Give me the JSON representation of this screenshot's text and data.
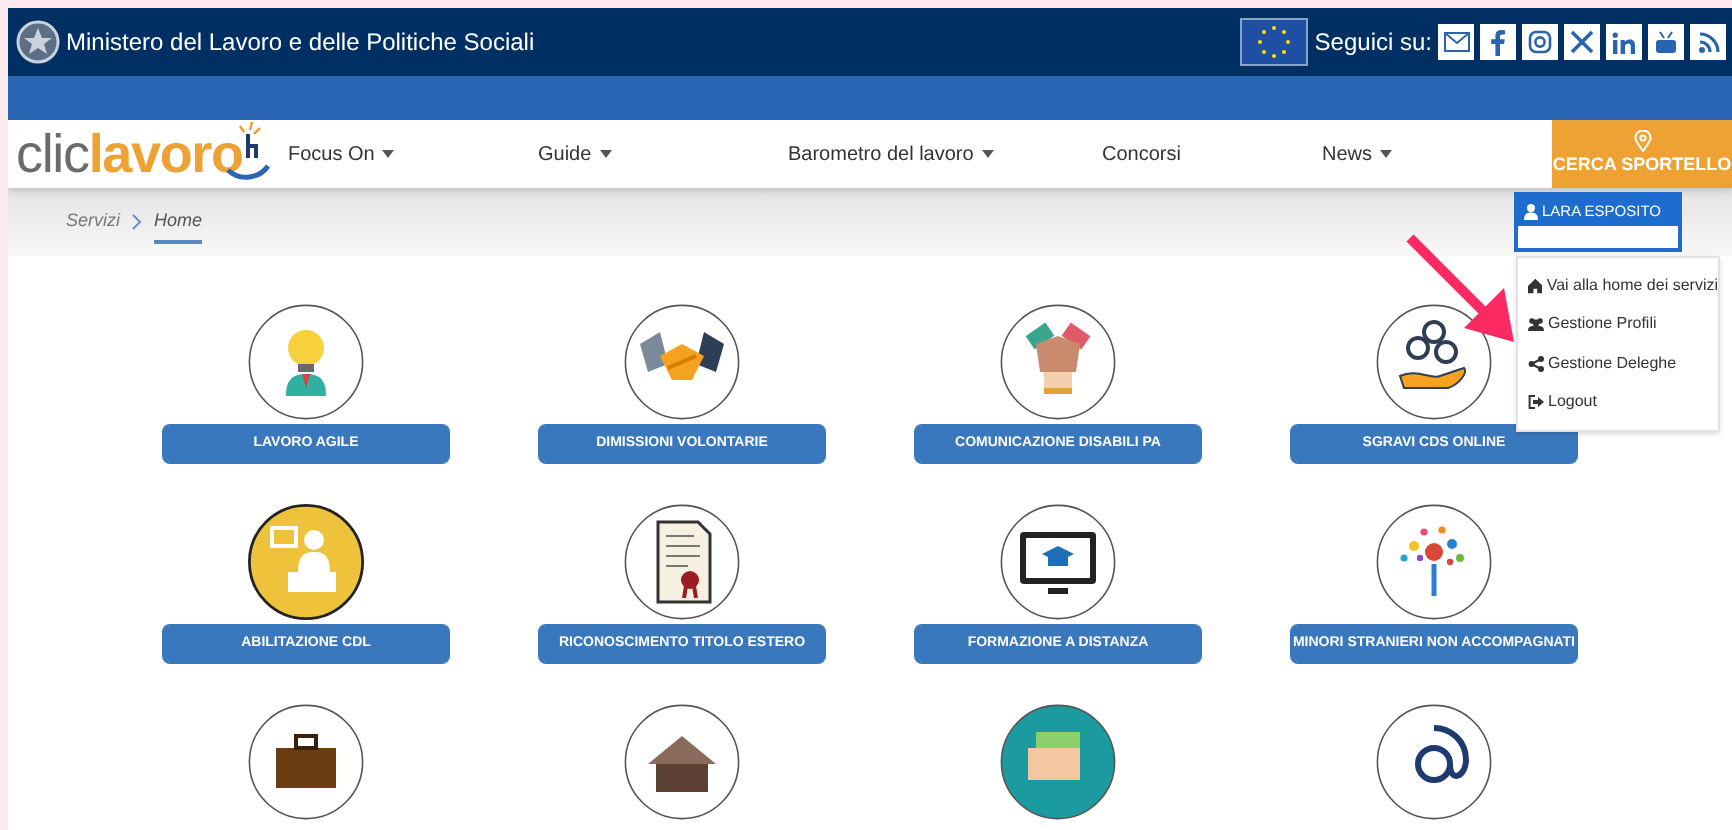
{
  "header": {
    "title": "Ministero del Lavoro e delle Politiche Sociali",
    "follow_label": "Seguici su:"
  },
  "nav": {
    "items": [
      {
        "label": "Focus On",
        "has_menu": true
      },
      {
        "label": "Guide",
        "has_menu": true
      },
      {
        "label": "Barometro del lavoro",
        "has_menu": true
      },
      {
        "label": "Concorsi",
        "has_menu": false
      },
      {
        "label": "News",
        "has_menu": true
      }
    ],
    "cta": "CERCA SPORTELLO"
  },
  "logo": {
    "part_1": "clic",
    "part_2": "lavoro"
  },
  "breadcrumb": [
    {
      "label": "Servizi",
      "selected": false
    },
    {
      "label": "Home",
      "selected": true
    }
  ],
  "user_menu": {
    "button": "LARA ESPOSITO",
    "items": [
      "Vai alla home dei servizi",
      "Gestione Profili",
      "Gestione Deleghe",
      "Logout"
    ]
  },
  "services": [
    {
      "kind": "labelled",
      "label": "LAVORO AGILE"
    },
    {
      "kind": "labelled",
      "label": "DIMISSIONI VOLONTARIE"
    },
    {
      "kind": "labelled",
      "label": "COMUNICAZIONE DISABILI PA"
    },
    {
      "kind": "labelled",
      "label": "SGRAVI CDS ONLINE"
    },
    {
      "kind": "labelled",
      "label": "ABILITAZIONE CDL"
    },
    {
      "kind": "labelled",
      "label": "RICONOSCIMENTO TITOLO ESTERO"
    },
    {
      "kind": "labelled",
      "label": "FORMAZIONE A DISTANZA"
    },
    {
      "kind": "labelled",
      "label": "MINORI STRANIERI NON ACCOMPAGNATI"
    },
    {
      "kind": "icon_only"
    },
    {
      "kind": "icon_only"
    },
    {
      "kind": "icon_only"
    },
    {
      "kind": "icon_only"
    }
  ]
}
